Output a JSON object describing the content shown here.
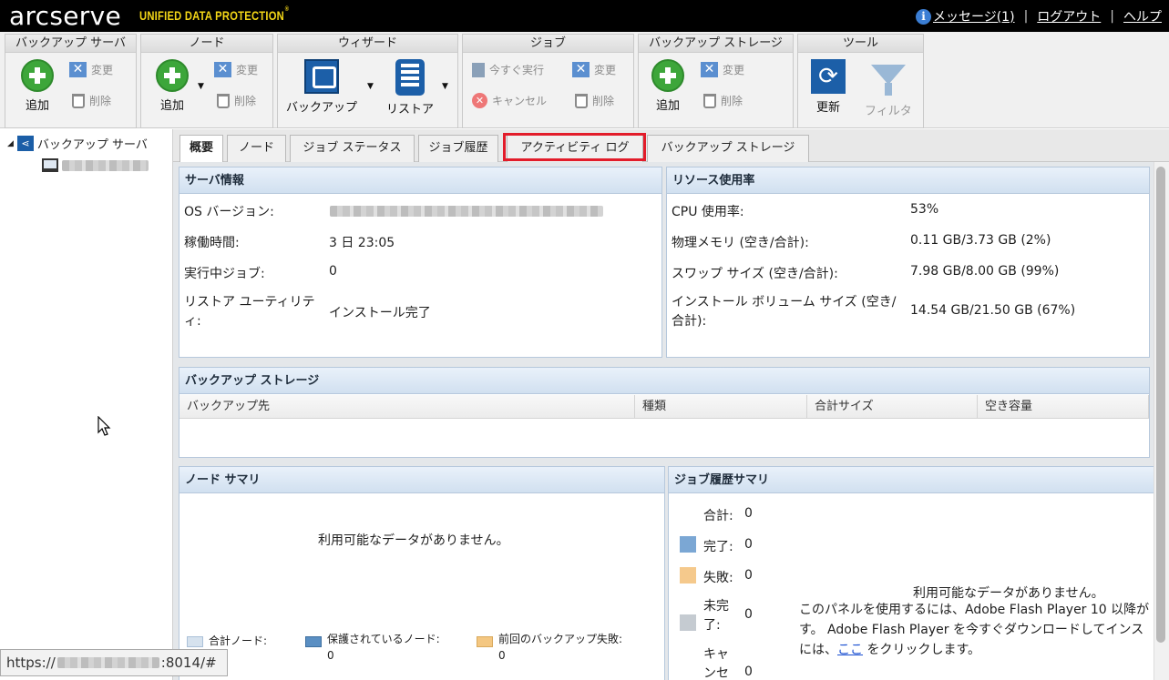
{
  "header": {
    "brand": "arcserve",
    "tagline": "UNIFIED DATA PROTECTION",
    "messages": "メッセージ(1)",
    "logout": "ログアウト",
    "help": "ヘルプ",
    "separator": "|"
  },
  "toolbar": {
    "backup_server": {
      "title": "バックアップ サーバ",
      "add": "追加",
      "modify": "変更",
      "delete": "削除"
    },
    "node": {
      "title": "ノード",
      "add": "追加",
      "modify": "変更",
      "delete": "削除"
    },
    "wizard": {
      "title": "ウィザード",
      "backup": "バックアップ",
      "restore": "リストア"
    },
    "job": {
      "title": "ジョブ",
      "run_now": "今すぐ実行",
      "modify": "変更",
      "cancel": "キャンセル",
      "delete": "削除"
    },
    "backup_storage": {
      "title": "バックアップ ストレージ",
      "add": "追加",
      "modify": "変更",
      "delete": "削除"
    },
    "tools": {
      "title": "ツール",
      "refresh": "更新",
      "filter": "フィルタ"
    }
  },
  "tree": {
    "root_label": "バックアップ サーバ"
  },
  "tabs": [
    "概要",
    "ノード",
    "ジョブ ステータス",
    "ジョブ履歴",
    "アクティビティ ログ",
    "バックアップ ストレージ"
  ],
  "server_info": {
    "title": "サーバ情報",
    "os_label": "OS バージョン:",
    "uptime_label": "稼働時間:",
    "uptime_value": "3 日 23:05",
    "running_jobs_label": "実行中ジョブ:",
    "running_jobs_value": "0",
    "restore_util_label": "リストア ユーティリティ:",
    "restore_util_value": "インストール完了"
  },
  "resource": {
    "title": "リソース使用率",
    "cpu_label": "CPU 使用率:",
    "cpu_value": "53%",
    "mem_label": "物理メモリ (空き/合計):",
    "mem_value": "0.11 GB/3.73 GB (2%)",
    "swap_label": "スワップ サイズ (空き/合計):",
    "swap_value": "7.98 GB/8.00 GB (99%)",
    "vol_label": "インストール ボリューム サイズ (空き/合計):",
    "vol_value": "14.54 GB/21.50 GB (67%)"
  },
  "storage": {
    "title": "バックアップ ストレージ",
    "columns": [
      "バックアップ先",
      "種類",
      "合計サイズ",
      "空き容量"
    ]
  },
  "node_summary": {
    "title": "ノード サマリ",
    "no_data": "利用可能なデータがありません。",
    "legend_total": "合計ノード:",
    "legend_protected": "保護されているノード: 0",
    "legend_last_failed": "前回のバックアップ失敗: 0"
  },
  "job_summary": {
    "title": "ジョブ履歴サマリ",
    "total_label": "合計:",
    "total_value": "0",
    "done_label": "完了:",
    "done_value": "0",
    "failed_label": "失敗:",
    "failed_value": "0",
    "incomplete_label": "未完了:",
    "incomplete_value": "0",
    "canceled_label": "キャンセ",
    "canceled_value": "0",
    "no_data": "利用可能なデータがありません。",
    "flash_line1": "このパネルを使用するには、Adobe Flash Player 10 以降が",
    "flash_line2": "す。 Adobe Flash Player を今すぐダウンロードしてインス",
    "flash_line3_pre": "には、",
    "flash_link": "ここ",
    "flash_line3_post": " をクリックします。"
  },
  "status_url": {
    "prefix": "https://",
    "suffix": ":8014/#"
  },
  "colors": {
    "done": "#7ba7d4",
    "failed": "#f5c98c",
    "incomplete": "#c5cbd1",
    "highlight": "#e21c2a",
    "accent": "#3b7ed4"
  }
}
